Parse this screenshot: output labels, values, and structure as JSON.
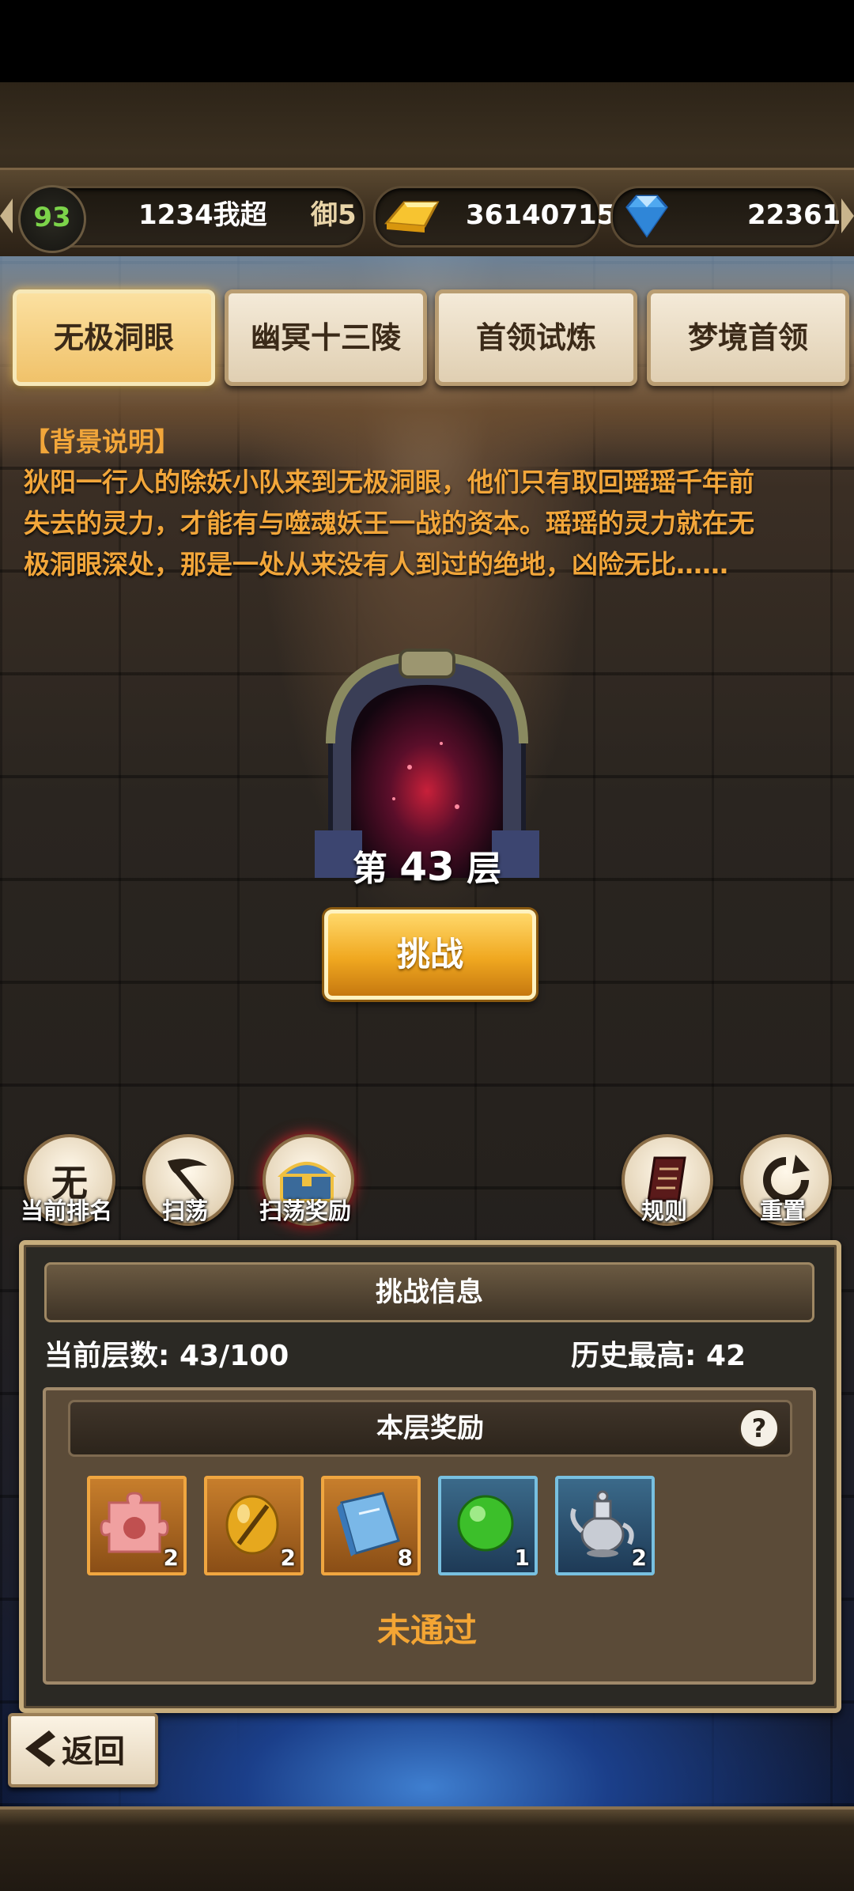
{
  "currency": {
    "level": "93",
    "player_name": "1234我超",
    "title_suffix": "御5",
    "gold": "36140715",
    "gems": "22361"
  },
  "tabs": [
    {
      "label": "无极洞眼",
      "active": true
    },
    {
      "label": "幽冥十三陵",
      "active": false
    },
    {
      "label": "首领试炼",
      "active": false
    },
    {
      "label": "梦境首领",
      "active": false
    }
  ],
  "background": {
    "title": "【背景说明】",
    "lines": [
      "狄阳一行人的除妖小队来到无极洞眼，他们只有取回瑶瑶千年前",
      "失去的灵力，才能有与噬魂妖王一战的资本。瑶瑶的灵力就在无",
      "极洞眼深处，那是一处从来没有人到过的绝地，凶险无比……"
    ]
  },
  "floor": {
    "prefix": "第",
    "number": "43",
    "suffix": "层"
  },
  "challenge_button": "挑战",
  "actions": {
    "rank": {
      "icon_text": "无",
      "label": "当前排名"
    },
    "sweep": {
      "label": "扫荡"
    },
    "sweep_reward": {
      "label": "扫荡奖励"
    },
    "rules": {
      "label": "规则"
    },
    "reset": {
      "label": "重置"
    }
  },
  "panel": {
    "title": "挑战信息",
    "current_label": "当前层数:",
    "current_value": "43/100",
    "best_label": "历史最高:",
    "best_value": "42",
    "reward_title": "本层奖励",
    "help": "?",
    "items": [
      {
        "icon": "puzzle-piece-icon",
        "count": "2",
        "rarity": "orange"
      },
      {
        "icon": "golden-egg-icon",
        "count": "2",
        "rarity": "orange"
      },
      {
        "icon": "blue-book-icon",
        "count": "8",
        "rarity": "orange"
      },
      {
        "icon": "green-orb-icon",
        "count": "1",
        "rarity": "blue"
      },
      {
        "icon": "silver-teapot-icon",
        "count": "2",
        "rarity": "blue"
      }
    ],
    "status": "未通过"
  },
  "back_button": "返回",
  "colors": {
    "accent_gold": "#f2a63a",
    "level_green": "#7cd44a"
  }
}
